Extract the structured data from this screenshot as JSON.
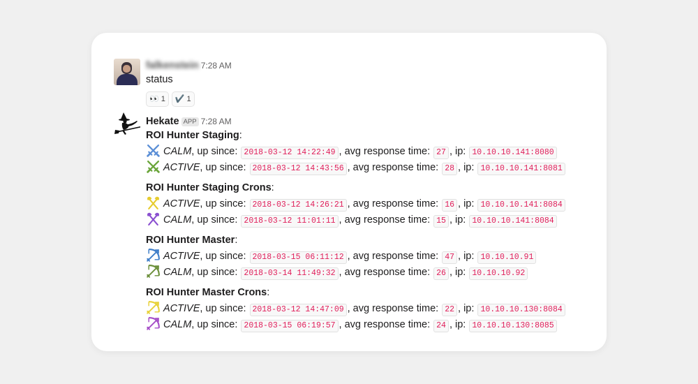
{
  "user_message": {
    "author": "falkenstein",
    "time": "7:28 AM",
    "text": "status",
    "reactions": [
      {
        "emoji": "👀",
        "count": "1",
        "icon": "eyes-icon"
      },
      {
        "emoji": "✔️",
        "count": "1",
        "icon": "checkmark-icon"
      }
    ]
  },
  "bot_message": {
    "author": "Hekate",
    "badge": "APP",
    "time": "7:28 AM",
    "labels": {
      "up_since": ", up since: ",
      "avg": ", avg response time: ",
      "ip": ", ip: "
    },
    "sections": [
      {
        "title": "ROI Hunter Staging",
        "rows": [
          {
            "icon": "crossed-swords-icon",
            "icon_color": "#5b8fd6",
            "status": "CALM",
            "since": "2018-03-12 14:22:49",
            "avg": "27",
            "ip": "10.10.10.141:8080"
          },
          {
            "icon": "crossed-swords-icon",
            "icon_color": "#6aa53a",
            "status": "ACTIVE",
            "since": "2018-03-12 14:43:56",
            "avg": "28",
            "ip": "10.10.10.141:8081"
          }
        ]
      },
      {
        "title": "ROI Hunter Staging Crons",
        "rows": [
          {
            "icon": "crossed-axes-icon",
            "icon_color": "#e6cc2e",
            "status": "ACTIVE",
            "since": "2018-03-12 14:26:21",
            "avg": "16",
            "ip": "10.10.10.141:8084"
          },
          {
            "icon": "crossed-axes-icon",
            "icon_color": "#8a4fd0",
            "status": "CALM",
            "since": "2018-03-12 11:01:11",
            "avg": "15",
            "ip": "10.10.10.141:8084"
          }
        ]
      },
      {
        "title": "ROI Hunter Master",
        "rows": [
          {
            "icon": "bow-arrow-icon",
            "icon_color": "#3f7ec9",
            "status": "ACTIVE",
            "since": "2018-03-15 06:11:12",
            "avg": "47",
            "ip": "10.10.10.91"
          },
          {
            "icon": "bow-arrow-icon",
            "icon_color": "#6b8f3a",
            "status": "CALM",
            "since": "2018-03-14 11:49:32",
            "avg": "26",
            "ip": "10.10.10.92"
          }
        ]
      },
      {
        "title": "ROI Hunter Master Crons",
        "rows": [
          {
            "icon": "bow-arrow-icon",
            "icon_color": "#e8d23a",
            "status": "ACTIVE",
            "since": "2018-03-12 14:47:09",
            "avg": "22",
            "ip": "10.10.10.130:8084"
          },
          {
            "icon": "bow-arrow-icon",
            "icon_color": "#a64fc8",
            "status": "CALM",
            "since": "2018-03-15 06:19:57",
            "avg": "24",
            "ip": "10.10.10.130:8085"
          }
        ]
      }
    ]
  }
}
